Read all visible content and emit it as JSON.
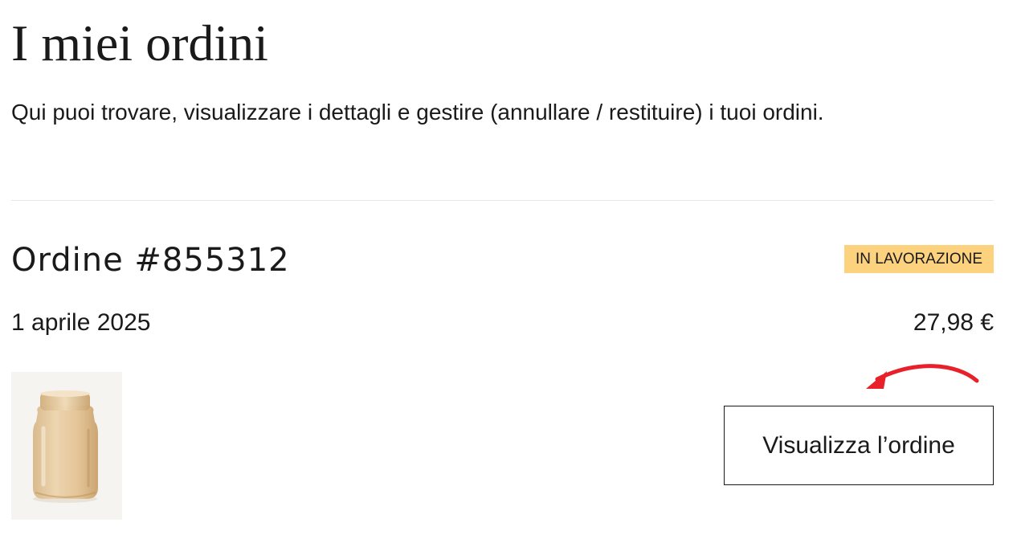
{
  "page": {
    "title": "I miei ordini",
    "subtitle": "Qui puoi trovare, visualizzare i dettagli e gestire (annullare / restituire) i tuoi ordini."
  },
  "order": {
    "number": "Ordine #855312",
    "status": "IN LAVORAZIONE",
    "date": "1 aprile 2025",
    "total": "27,98 €",
    "product_image": "amber-glass-vase",
    "view_button_label": "Visualizza l’ordine"
  },
  "colors": {
    "status_badge_bg": "#fdd27e",
    "annotation_arrow": "#e8202a",
    "text": "#1a1a1a",
    "divider": "#e6e6e6"
  },
  "icons": {
    "annotation": "curved-arrow-icon"
  }
}
